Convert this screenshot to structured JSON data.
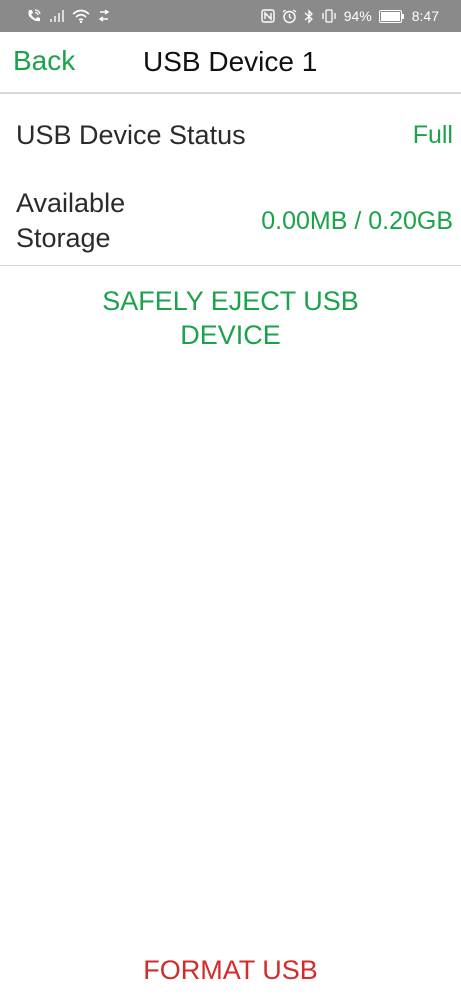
{
  "status_bar": {
    "battery_percent": "94%",
    "time": "8:47",
    "icons_left": [
      "call-wifi-icon",
      "signal-icon",
      "wifi-icon",
      "data-arrows-icon"
    ],
    "icons_right": [
      "nfc-icon",
      "alarm-icon",
      "bluetooth-icon",
      "vibrate-icon",
      "battery-icon"
    ]
  },
  "nav": {
    "back_label": "Back",
    "title": "USB Device 1"
  },
  "info": {
    "status_label": "USB Device Status",
    "status_value": "Full",
    "storage_label": "Available Storage",
    "storage_value": "0.00MB / 0.20GB"
  },
  "actions": {
    "eject_label": "SAFELY EJECT USB DEVICE",
    "format_label": "FORMAT USB"
  },
  "colors": {
    "accent_green": "#1aa34a",
    "danger_red": "#d62a2a",
    "status_bar_bg": "#8a8a8a"
  }
}
